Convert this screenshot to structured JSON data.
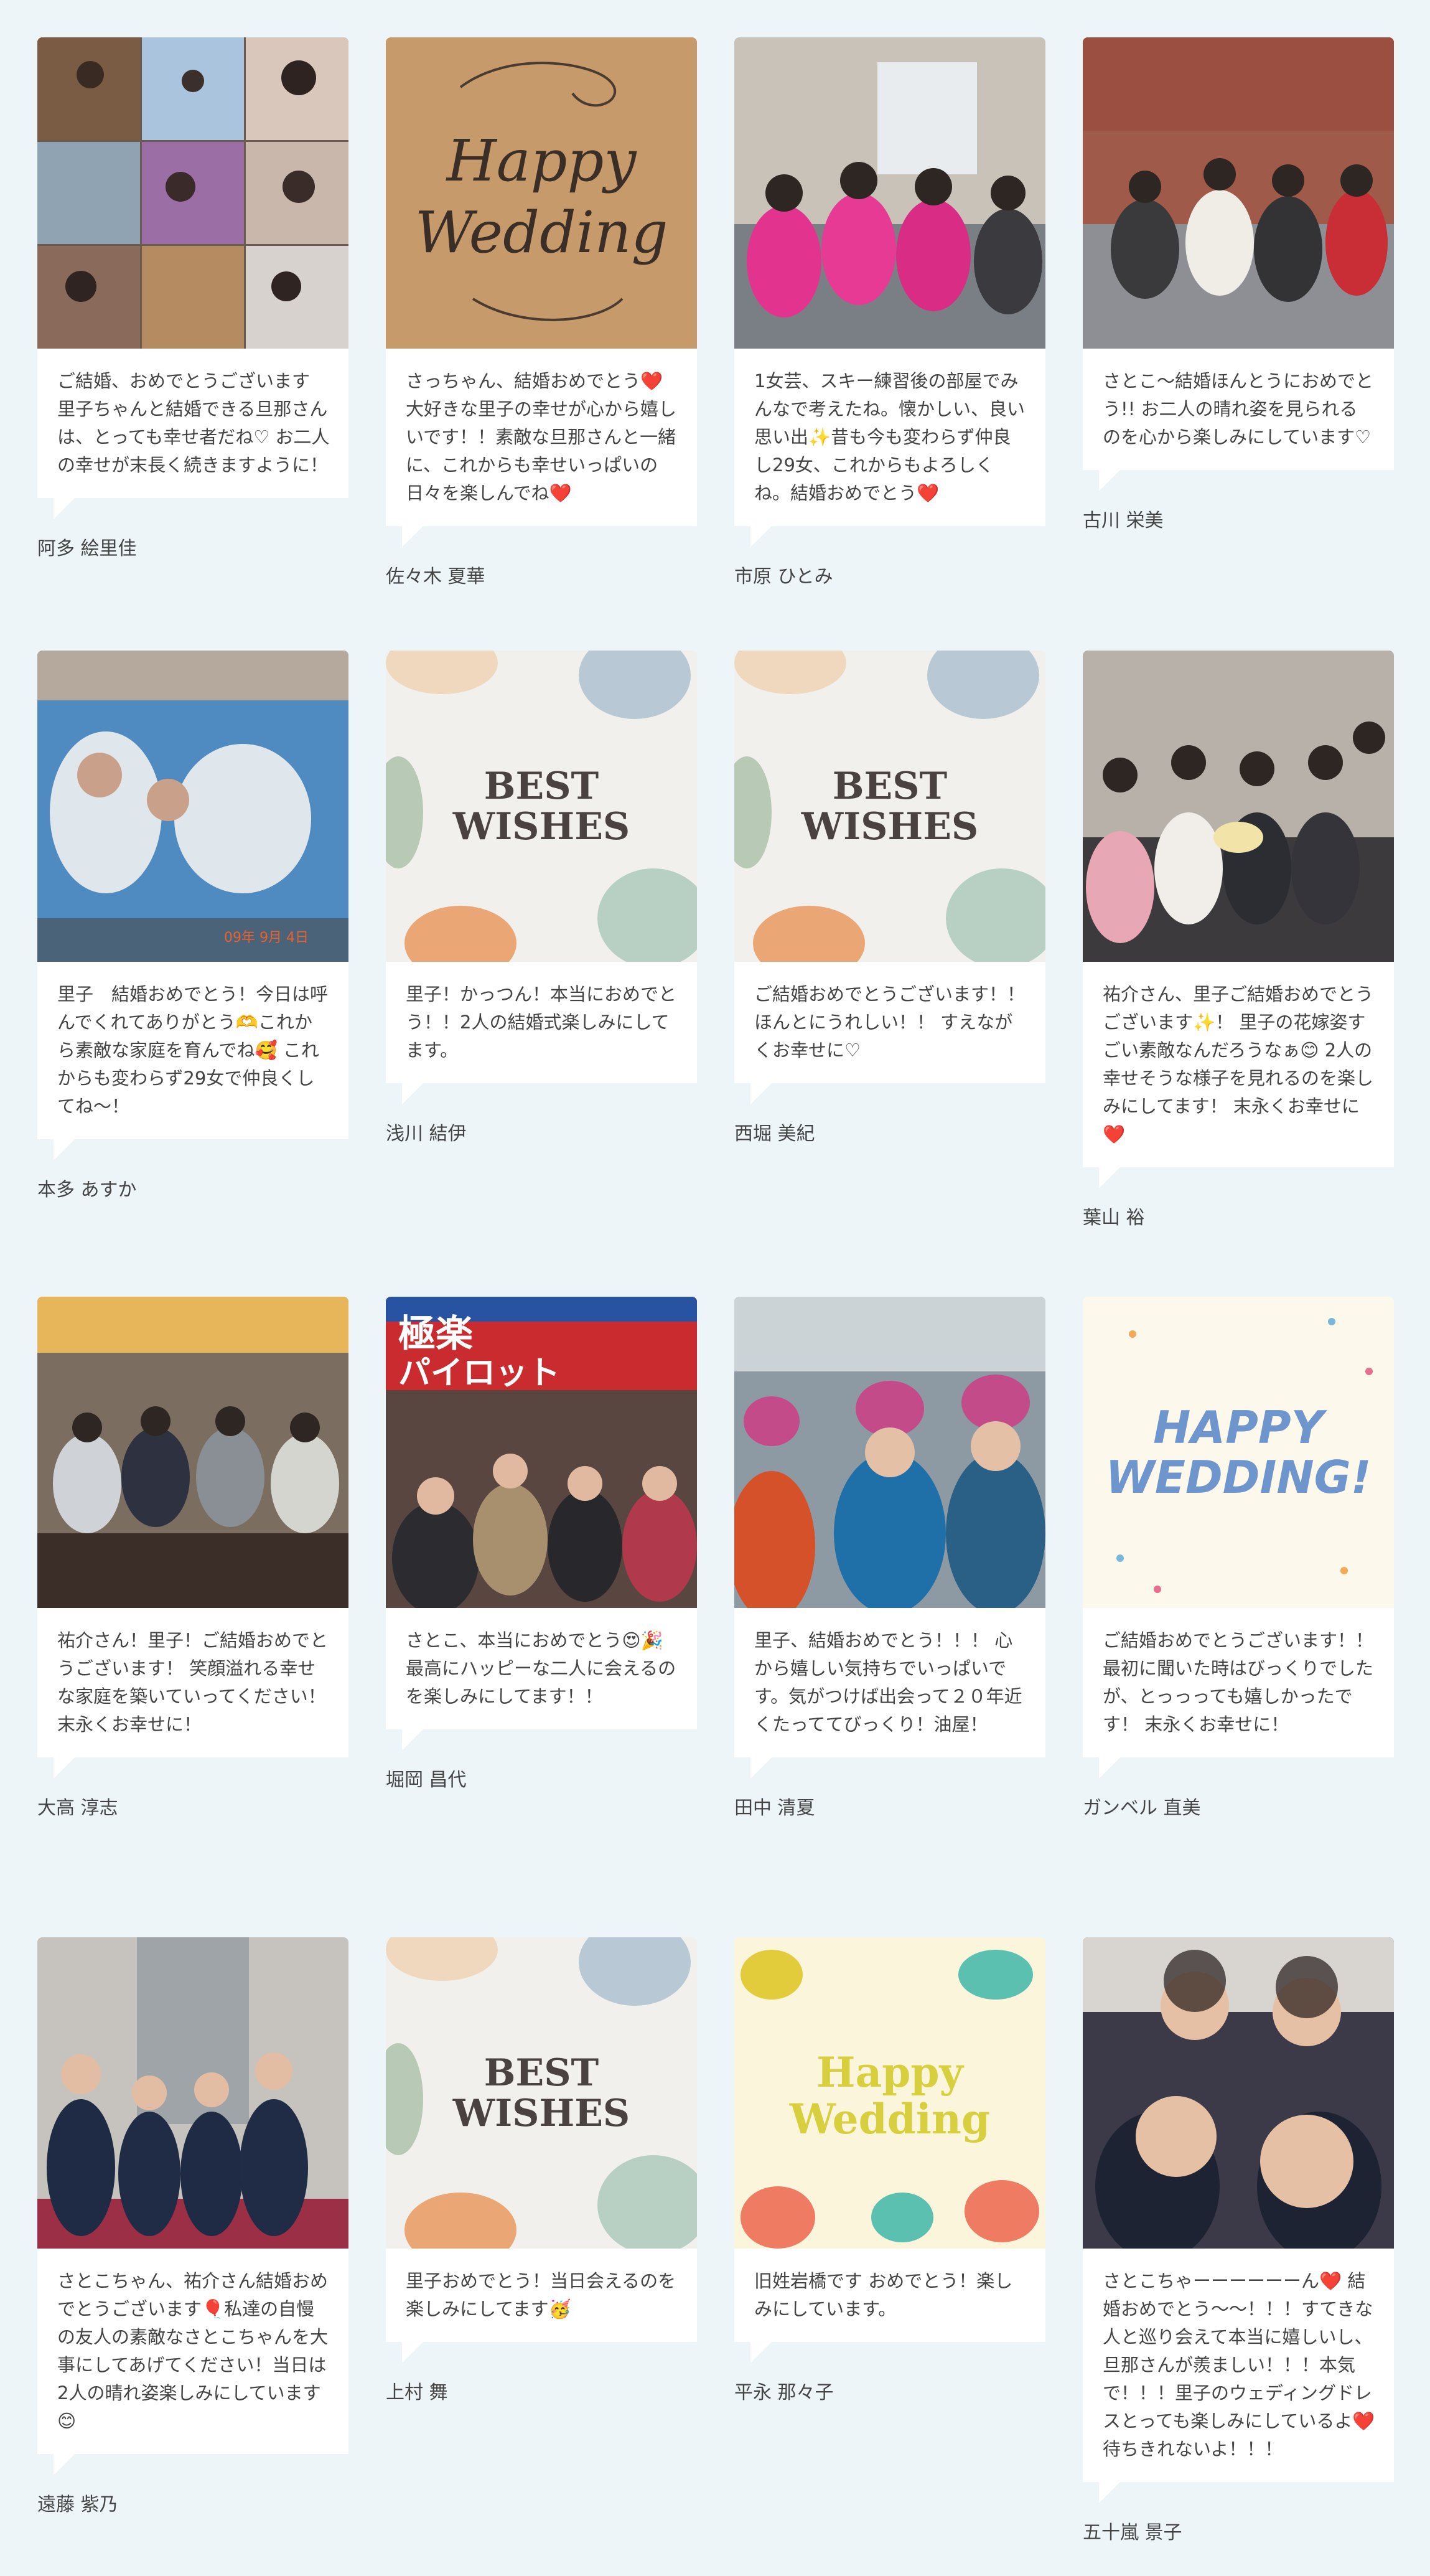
{
  "colors": {
    "page_bg": "#eef5f8",
    "card_bg": "#ffffff",
    "text": "#444444",
    "happy_wedding_blue": "#6e95cc",
    "best_wishes_text": "#4a4240",
    "kraft": "#c79a6b",
    "yellow_text": "#d8cf3e"
  },
  "cards": [
    {
      "photo": "photo-collage-friends",
      "message": "ご結婚、おめでとうございます 里子ちゃんと結婚できる旦那さんは、とっても幸せ者だね♡ お二人の幸せが末長く続きますように！",
      "author": "阿多 絵里佳"
    },
    {
      "photo": "happy-wedding-kraft-card",
      "photo_text": [
        "Happy",
        "Wedding"
      ],
      "message": "さっちゃん、結婚おめでとう❤️大好きな里子の幸せが心から嬉しいです！！素敵な旦那さんと一緒に、これからも幸せいっぱいの日々を楽しんでね❤️",
      "author": "佐々木 夏華"
    },
    {
      "photo": "pink-tshirt-group-photo",
      "message": "1女芸、スキー練習後の部屋でみんなで考えたね。懐かしい、良い思い出✨昔も今も変わらず仲良し29女、これからもよろしくね。結婚おめでとう❤️",
      "author": "市原 ひとみ"
    },
    {
      "photo": "station-group-photo",
      "message": "さとこ〜結婚ほんとうにおめでとう!! お二人の晴れ姿を見られるのを心から楽しみにしています♡",
      "author": "古川 栄美"
    },
    {
      "photo": "seal-face-cutout-photo",
      "photo_text": [
        "09年 9月 4日"
      ],
      "message": "里子　結婚おめでとう！今日は呼んでくれてありがとう🫶これから素敵な家庭を育んでね🥰 これからも変わらず29女で仲良くしてね〜！",
      "author": "本多 あすか"
    },
    {
      "photo": "best-wishes-card",
      "photo_text": [
        "BEST",
        "WISHES"
      ],
      "message": "里子！かっつん！本当におめでとう！！2人の結婚式楽しみにしてます。",
      "author": "浅川 結伊"
    },
    {
      "photo": "best-wishes-card",
      "photo_text": [
        "BEST",
        "WISHES"
      ],
      "message": "ご結婚おめでとうございます！！ほんとにうれしい！！ すえながくお幸せに♡",
      "author": "西堀 美紀"
    },
    {
      "photo": "birthday-group-photo",
      "message": "祐介さん、里子ご結婚おめでとうございます✨！ 里子の花嫁姿すごい素敵なんだろうなぁ😊 2人の幸せそうな様子を見れるのを楽しみにしてます！ 末永くお幸せに❤️",
      "author": "葉山 裕"
    },
    {
      "photo": "bbq-group-photo",
      "message": "祐介さん！里子！ご結婚おめでとうございます！ 笑顔溢れる幸せな家庭を築いていってください！末永くお幸せに！",
      "author": "大高 淳志"
    },
    {
      "photo": "gokuraku-pilot-photo",
      "photo_text": [
        "極楽",
        "パイロット"
      ],
      "message": "さとこ、本当におめでとう😍🎉最高にハッピーな二人に会えるのを楽しみにしてます！！",
      "author": "堀岡 昌代"
    },
    {
      "photo": "ski-wear-photo",
      "message": "里子、結婚おめでとう！！！ 心から嬉しい気持ちでいっぱいです。気がつけば出会って２０年近くたっててびっくり！油屋！",
      "author": "田中 清夏"
    },
    {
      "photo": "happy-wedding-confetti-card",
      "photo_text": [
        "HAPPY",
        "WEDDING!"
      ],
      "message": "ご結婚おめでとうございます！！最初に聞いた時はびっくりでしたが、とっっっても嬉しかったです！ 末永くお幸せに！",
      "author": "ガンベル 直美"
    },
    {
      "photo": "uniform-escalator-photo",
      "message": "さとこちゃん、祐介さん結婚おめでとうございます🎈私達の自慢の友人の素敵なさとこちゃんを大事にしてあげてください！当日は2人の晴れ姿楽しみにしています😊",
      "author": "遠藤 紫乃"
    },
    {
      "photo": "best-wishes-card",
      "photo_text": [
        "BEST",
        "WISHES"
      ],
      "message": "里子おめでとう！当日会えるのを楽しみにしてます🥳",
      "author": "上村 舞"
    },
    {
      "photo": "happy-wedding-illustrated-card",
      "photo_text": [
        "Happy",
        "Wedding"
      ],
      "message": "旧姓岩橋です おめでとう！楽しみにしています。",
      "author": "平永 那々子"
    },
    {
      "photo": "uniform-selfie-photo",
      "message": "さとこちゃーーーーーーん❤️ 結婚おめでとう〜〜！！！すてきな人と巡り会えて本当に嬉しいし、旦那さんが羨ましい！！！本気で！！！里子のウェディングドレスとっても楽しみにしているよ❤️待ちきれないよ！！！",
      "author": "五十嵐 景子"
    }
  ]
}
